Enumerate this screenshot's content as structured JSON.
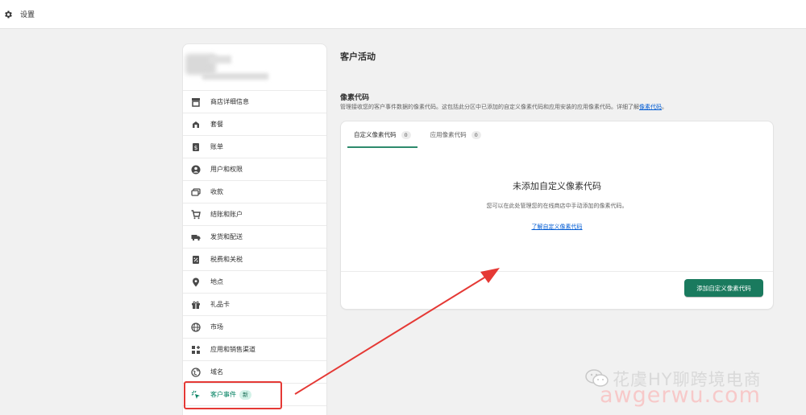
{
  "topbar": {
    "title": "设置",
    "icon": "gear-icon"
  },
  "sidebar": {
    "items": [
      {
        "label": "商店详细信息",
        "icon": "store-icon",
        "active": false
      },
      {
        "label": "套餐",
        "icon": "plan-icon",
        "active": false
      },
      {
        "label": "账单",
        "icon": "billing-icon",
        "active": false
      },
      {
        "label": "用户和权限",
        "icon": "user-icon",
        "active": false
      },
      {
        "label": "收款",
        "icon": "payments-icon",
        "active": false
      },
      {
        "label": "结账和账户",
        "icon": "cart-icon",
        "active": false
      },
      {
        "label": "发货和配送",
        "icon": "truck-icon",
        "active": false
      },
      {
        "label": "税费和关税",
        "icon": "tax-icon",
        "active": false
      },
      {
        "label": "地点",
        "icon": "location-pin-icon",
        "active": false
      },
      {
        "label": "礼品卡",
        "icon": "gift-icon",
        "active": false
      },
      {
        "label": "市场",
        "icon": "globe-icon",
        "active": false
      },
      {
        "label": "应用和销售渠道",
        "icon": "apps-icon",
        "active": false
      },
      {
        "label": "域名",
        "icon": "domain-icon",
        "active": false
      },
      {
        "label": "客户事件",
        "icon": "customer-events-icon",
        "active": true,
        "badge": "新"
      }
    ]
  },
  "main": {
    "page_title": "客户活动",
    "section_title": "像素代码",
    "section_desc": "管理接收您的客户事件数据的像素代码。这包括此分区中已添加的自定义像素代码和应用安装的应用像素代码。详细了解",
    "section_desc_link": "像素代码",
    "section_desc_end": "。",
    "tabs": [
      {
        "label": "自定义像素代码",
        "count": "0",
        "active": true
      },
      {
        "label": "应用像素代码",
        "count": "0",
        "active": false
      }
    ],
    "empty_title": "未添加自定义像素代码",
    "empty_desc": "您可以在此处管理您的在线商店中手动添加的像素代码。",
    "empty_link": "了解自定义像素代码",
    "primary_button": "添加自定义像素代码"
  },
  "watermark": {
    "line1": "花虞HY聊跨境电商",
    "line2": "awgerwu.com"
  },
  "colors": {
    "accent": "#1a7a5e",
    "annotation": "#e53935",
    "link": "#005bd3"
  }
}
